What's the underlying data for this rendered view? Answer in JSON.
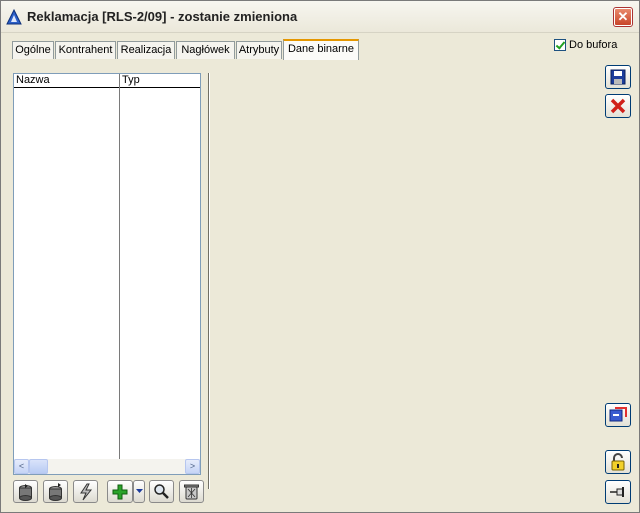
{
  "window": {
    "title": "Reklamacja  [RLS-2/09] - zostanie zmieniona",
    "close_label": "✕"
  },
  "tabs": [
    {
      "label": "Ogólne"
    },
    {
      "label": "Kontrahent"
    },
    {
      "label": "Realizacja"
    },
    {
      "label": "Nagłówek"
    },
    {
      "label": "Atrybuty"
    },
    {
      "label": "Dane binarne",
      "active": true
    }
  ],
  "do_bufora": {
    "label": "Do bufora",
    "checked": true
  },
  "binary_list": {
    "columns": [
      "Nazwa",
      "Typ"
    ],
    "rows": []
  },
  "scroll": {
    "left": "<",
    "right": ">"
  },
  "toolbar_icons": [
    "database-import-icon",
    "database-export-icon",
    "lightning-icon",
    "add-icon",
    "dropdown-arrow-icon",
    "search-icon",
    "trash-icon"
  ],
  "side_icons": [
    "save-icon",
    "cancel-icon",
    "attachment-icon",
    "unlock-icon",
    "pin-icon"
  ],
  "colors": {
    "accent_tab": "#e59700",
    "save_blue": "#1c3c9c",
    "cancel_red": "#d0201a",
    "add_green": "#2aa32a"
  }
}
